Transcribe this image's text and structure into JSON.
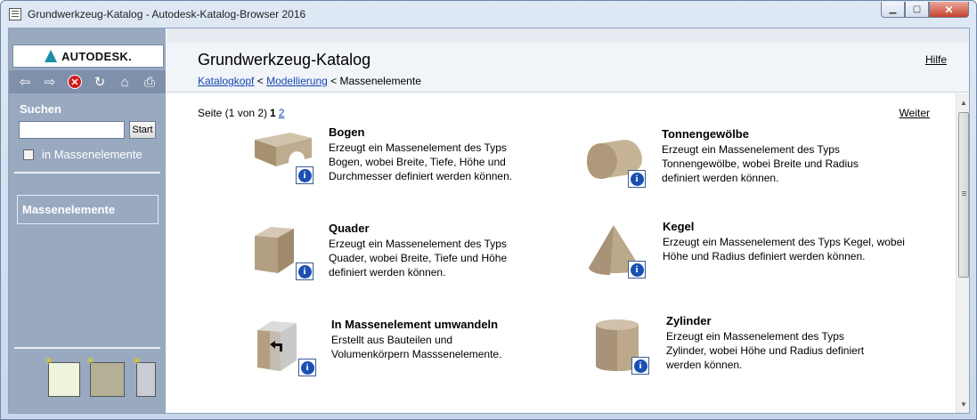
{
  "window": {
    "title": "Grundwerkzeug-Katalog - Autodesk-Katalog-Browser 2016",
    "controls": {
      "minimize": "▁",
      "maximize": "▢",
      "close": "✕"
    }
  },
  "sidebar": {
    "logo": "AUTODESK.",
    "nav": {
      "back": "⇦",
      "forward": "⇨",
      "stop": "✕",
      "refresh": "↻",
      "home": "⌂",
      "print": "⎙"
    },
    "search": {
      "label": "Suchen",
      "input_value": "",
      "button_label": "Start",
      "scope_label": "in Massenelemente",
      "scope_checked": false
    },
    "section": "Massenelemente"
  },
  "header": {
    "title": "Grundwerkzeug-Katalog",
    "help": "Hilfe",
    "breadcrumb": {
      "link1": "Katalogkopf",
      "sep1": " < ",
      "link2": "Modellierung",
      "sep2": " < ",
      "current": "Massenelemente"
    }
  },
  "pager": {
    "prefix": "Seite (1 von 2)",
    "current": "1",
    "page2": "2",
    "next": "Weiter"
  },
  "items": [
    {
      "title": "Bogen",
      "desc": "Erzeugt ein Massenelement des Typs Bogen, wobei Breite, Tiefe, Höhe und Durchmesser definiert werden können.",
      "icon": "arch-icon"
    },
    {
      "title": "Tonnengewölbe",
      "desc": "Erzeugt ein Massenelement des Typs Tonnengewölbe, wobei Breite und Radius definiert werden können.",
      "icon": "barrel-vault-icon"
    },
    {
      "title": "Quader",
      "desc": "Erzeugt ein Massenelement des Typs Quader, wobei Breite, Tiefe und Höhe definiert werden können.",
      "icon": "box-icon"
    },
    {
      "title": "Kegel",
      "desc": "Erzeugt ein Massenelement des Typs Kegel, wobei Höhe und Radius definiert werden können.",
      "icon": "cone-icon"
    },
    {
      "title": "In Massenelement umwandeln",
      "desc": "Erstellt aus Bauteilen und Volumenkörpern Masssenelemente.",
      "icon": "convert-icon"
    },
    {
      "title": "Zylinder",
      "desc": "Erzeugt ein Massenelement des Typs Zylinder, wobei Höhe und Radius definiert werden können.",
      "icon": "cylinder-icon"
    }
  ],
  "info_badge": "i",
  "colors": {
    "sidebar": "#99a9c0",
    "link": "#1546b3",
    "shape": "#b8a48a"
  }
}
